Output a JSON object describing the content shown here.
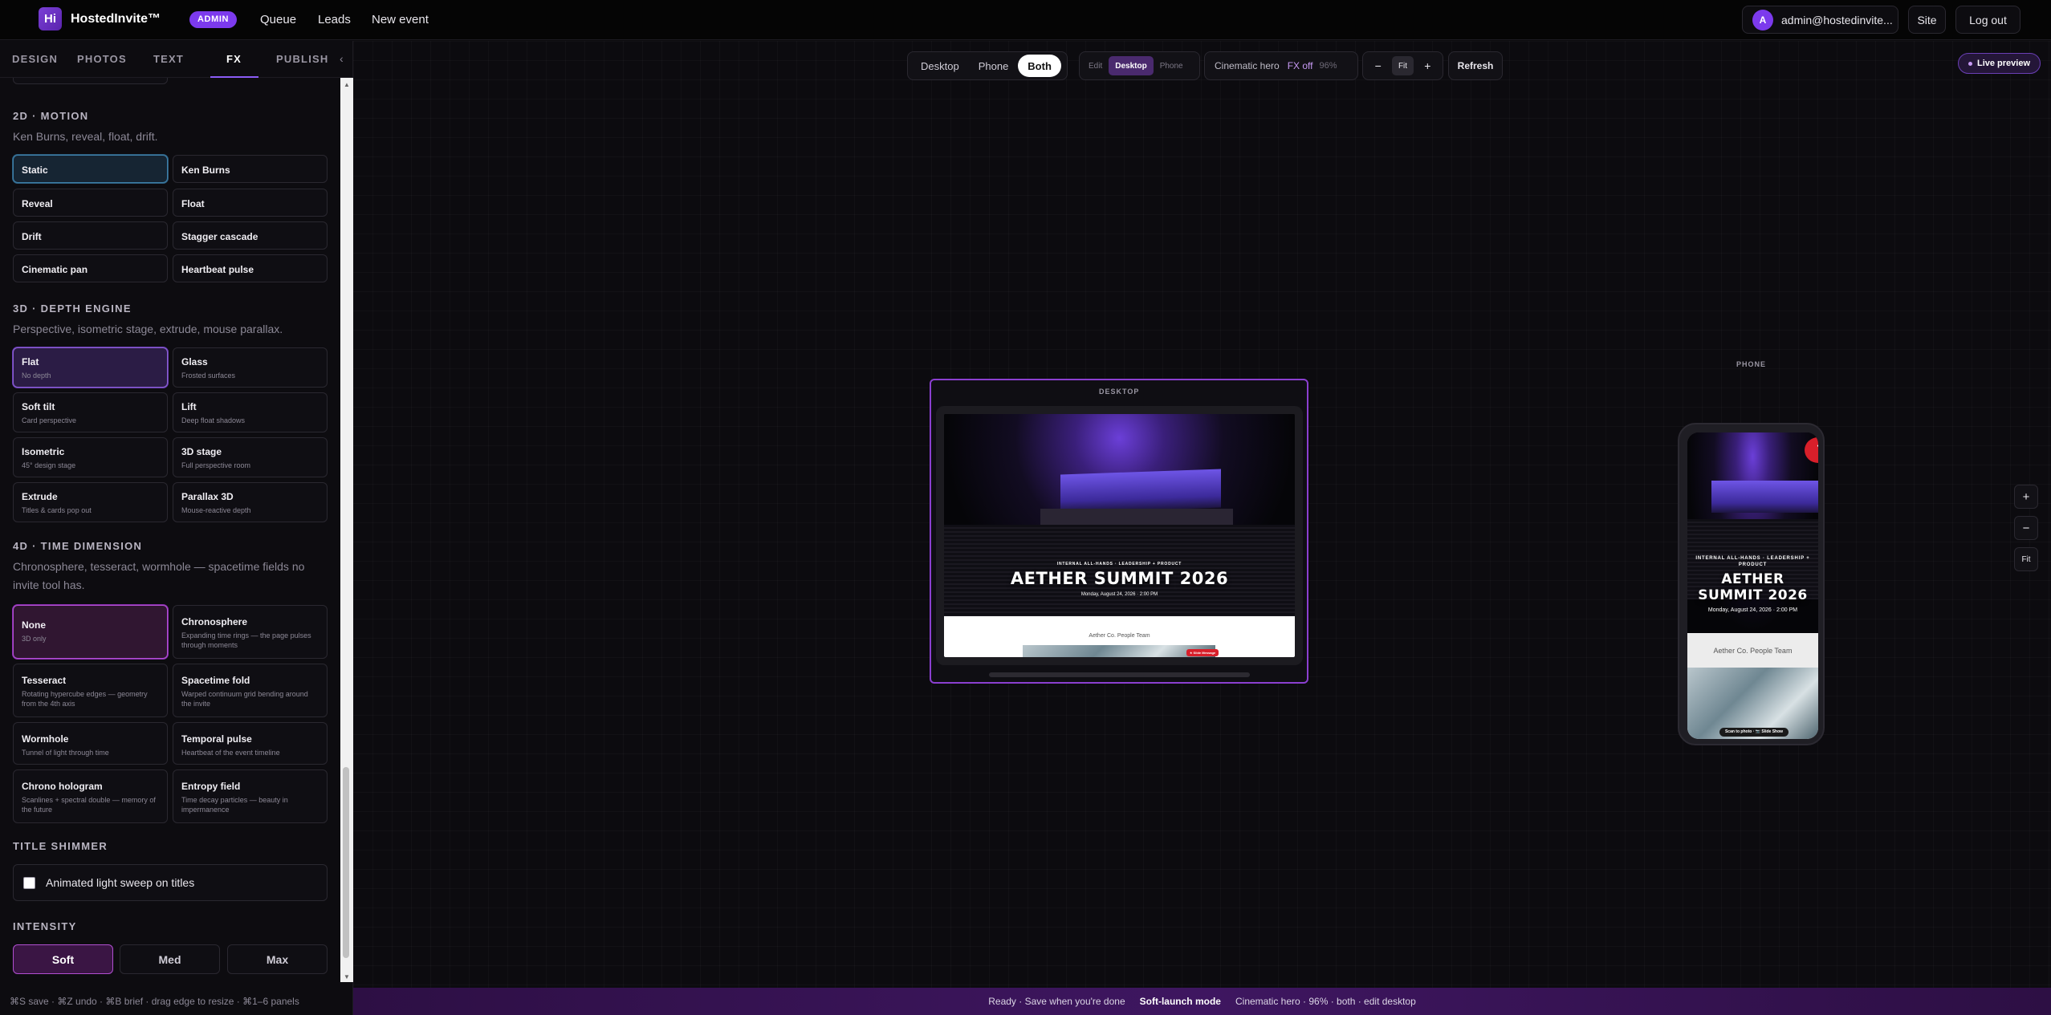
{
  "nav": {
    "logo": "Hi",
    "brand": "HostedInvite™",
    "badge": "ADMIN",
    "links": [
      "Queue",
      "Leads",
      "New event"
    ],
    "user_initial": "A",
    "user_email": "admin@hostedinvite...",
    "site_label": "Site",
    "logout_label": "Log out"
  },
  "sidebar": {
    "tabs": [
      "DESIGN",
      "PHOTOS",
      "TEXT",
      "FX",
      "PUBLISH"
    ],
    "active_tab": "FX",
    "collapse_glyph": "‹",
    "motion": {
      "title": "2D · MOTION",
      "desc": "Ken Burns, reveal, float, drift.",
      "options": [
        "Static",
        "Ken Burns",
        "Reveal",
        "Float",
        "Drift",
        "Stagger cascade",
        "Cinematic pan",
        "Heartbeat pulse"
      ],
      "selected": "Static"
    },
    "depth": {
      "title": "3D · DEPTH ENGINE",
      "desc": "Perspective, isometric stage, extrude, mouse parallax.",
      "options": [
        {
          "title": "Flat",
          "sub": "No depth"
        },
        {
          "title": "Glass",
          "sub": "Frosted surfaces"
        },
        {
          "title": "Soft tilt",
          "sub": "Card perspective"
        },
        {
          "title": "Lift",
          "sub": "Deep float shadows"
        },
        {
          "title": "Isometric",
          "sub": "45° design stage"
        },
        {
          "title": "3D stage",
          "sub": "Full perspective room"
        },
        {
          "title": "Extrude",
          "sub": "Titles & cards pop out"
        },
        {
          "title": "Parallax 3D",
          "sub": "Mouse-reactive depth"
        }
      ],
      "selected": "Flat"
    },
    "time": {
      "title": "4D · TIME DIMENSION",
      "desc": "Chronosphere, tesseract, wormhole — spacetime fields no invite tool has.",
      "options": [
        {
          "title": "None",
          "sub": "3D only"
        },
        {
          "title": "Chronosphere",
          "sub": "Expanding time rings — the page pulses through moments"
        },
        {
          "title": "Tesseract",
          "sub": "Rotating hypercube edges — geometry from the 4th axis"
        },
        {
          "title": "Spacetime fold",
          "sub": "Warped continuum grid bending around the invite"
        },
        {
          "title": "Wormhole",
          "sub": "Tunnel of light through time"
        },
        {
          "title": "Temporal pulse",
          "sub": "Heartbeat of the event timeline"
        },
        {
          "title": "Chrono hologram",
          "sub": "Scanlines + spectral double — memory of the future"
        },
        {
          "title": "Entropy field",
          "sub": "Time decay particles — beauty in impermanence"
        }
      ],
      "selected": "None"
    },
    "shimmer": {
      "title": "TITLE SHIMMER",
      "checkbox_label": "Animated light sweep on titles",
      "checked": false
    },
    "intensity": {
      "title": "INTENSITY",
      "options": [
        "Soft",
        "Med",
        "Max"
      ],
      "selected": "Soft"
    },
    "shortcuts": "⌘S save · ⌘Z undo · ⌘B brief · drag edge to resize · ⌘1–6 panels"
  },
  "toolbar": {
    "views": [
      "Desktop",
      "Phone",
      "Both"
    ],
    "active_view": "Both",
    "edit_label": "Edit",
    "edit_options": [
      "Desktop",
      "Phone"
    ],
    "active_edit": "Desktop",
    "hero_label": "Cinematic hero",
    "fx_label": "FX off",
    "zoom_value": "96%",
    "zoom_minus": "−",
    "zoom_fit": "Fit",
    "zoom_plus": "+",
    "refresh_label": "Refresh",
    "live_preview": "Live preview"
  },
  "canvas_controls": {
    "zoom_in": "+",
    "zoom_out": "−",
    "fit": "Fit"
  },
  "preview": {
    "desktop_label": "DESKTOP",
    "phone_label": "PHONE",
    "kicker": "INTERNAL ALL-HANDS · LEADERSHIP + PRODUCT",
    "title": "AETHER SUMMIT 2026",
    "date": "Monday, August 24, 2026 · 2:00 PM",
    "org": "Aether Co. People Team",
    "phone_tag": "Scan to photo · 📷 Slide Show",
    "desktop_tag": "★ Slide Message"
  },
  "status": {
    "ready": "Ready · Save when you're done",
    "mode": "Soft-launch mode",
    "summary": "Cinematic hero · 96% · both · edit desktop"
  },
  "colors": {
    "accent": "#8b5cf6",
    "admin_badge": "#7c3aed",
    "status_bar": "#3e1660"
  }
}
